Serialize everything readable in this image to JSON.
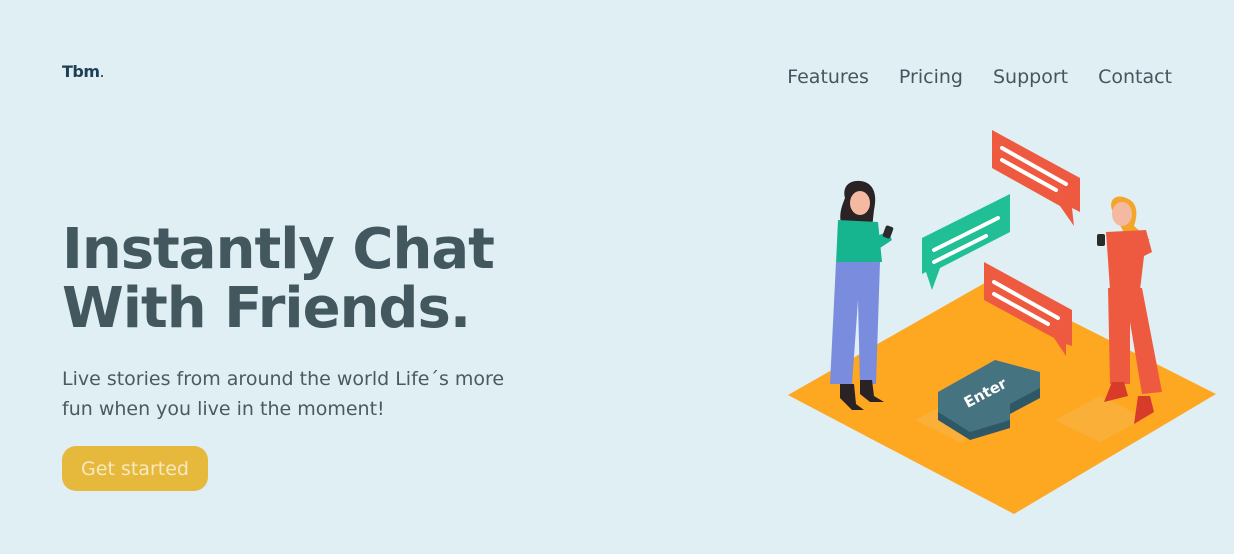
{
  "brand": {
    "logo_text": "Tbm",
    "logo_dot": "."
  },
  "nav": {
    "items": [
      {
        "label": "Features"
      },
      {
        "label": "Pricing"
      },
      {
        "label": "Support"
      },
      {
        "label": "Contact"
      }
    ]
  },
  "hero": {
    "headline_line1": "Instantly Chat",
    "headline_line2": "With Friends.",
    "subtitle_line1": "Live stories from around the world Life´s more",
    "subtitle_line2": "fun when you live in the moment!",
    "cta_label": "Get started"
  },
  "illustration": {
    "key_label": "Enter"
  },
  "colors": {
    "background": "#dfeff3",
    "heading": "#42575e",
    "cta": "#e6b93c",
    "platform": "#fea721",
    "bubble_red": "#ee5a3f",
    "bubble_green": "#21bf96",
    "key": "#45737f"
  }
}
